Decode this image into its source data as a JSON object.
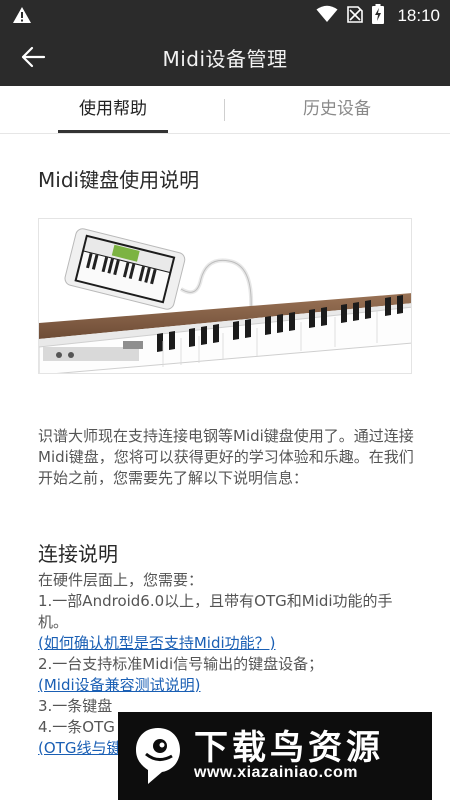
{
  "status_bar": {
    "time": "18:10",
    "icons": [
      "warning-icon",
      "wifi-icon",
      "no-sim-icon",
      "battery-charging-icon"
    ]
  },
  "app_bar": {
    "back_icon": "arrow-left-icon",
    "title": "Midi设备管理"
  },
  "tabs": [
    {
      "label": "使用帮助",
      "active": true
    },
    {
      "label": "历史设备",
      "active": false
    }
  ],
  "content": {
    "midi_heading": "Midi键盘使用说明",
    "hero_image_alt": "手机连接Midi键盘",
    "intro": "识谱大师现在支持连接电钢等Midi键盘使用了。通过连接Midi键盘，您将可以获得更好的学习体验和乐趣。在我们开始之前，您需要先了解以下说明信息：",
    "connect_heading": "连接说明",
    "hw_intro": "在硬件层面上，您需要：",
    "item1": "1.一部Android6.0以上，且带有OTG和Midi功能的手机。",
    "link1": "(如何确认机型是否支持Midi功能？)",
    "item2": "2.一台支持标准Midi信号输出的键盘设备；",
    "link2": "(Midi设备兼容测试说明)",
    "item3": "3.一条键盘",
    "item4": "4.一条OTG",
    "link3": "(OTG线与键"
  },
  "watermark": {
    "name": "下载鸟资源",
    "url": "www.xiazainiao.com"
  },
  "colors": {
    "bar_bg": "#2b2b2b",
    "link": "#1a5fb4",
    "text": "#555555"
  }
}
